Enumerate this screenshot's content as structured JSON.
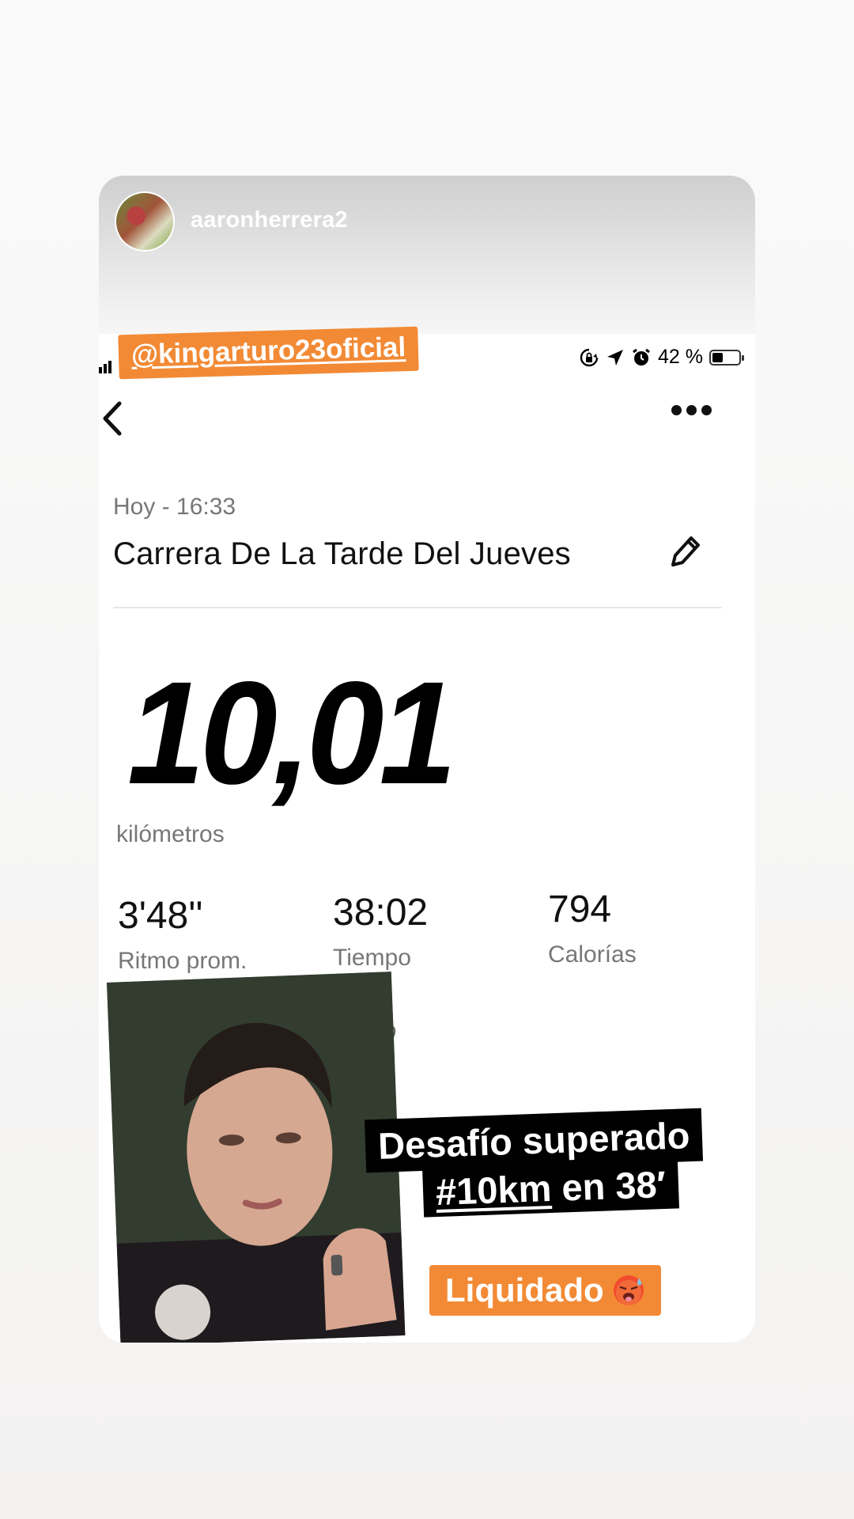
{
  "story": {
    "username": "aaronherrera2",
    "mention": "@kingarturo23oficial"
  },
  "status_bar": {
    "battery_percent": "42 %",
    "icons": [
      "orientation-lock-icon",
      "location-arrow-icon",
      "alarm-icon",
      "battery-icon"
    ]
  },
  "activity": {
    "date": "Hoy - 16:33",
    "title": "Carrera De La Tarde Del Jueves",
    "distance": "10,01",
    "distance_unit": "kilómetros",
    "stats": [
      {
        "value": "3'48''",
        "label": "Ritmo prom."
      },
      {
        "value": "38:02",
        "label": "Tiempo"
      },
      {
        "value": "794",
        "label": "Calorías"
      }
    ],
    "partial_text": "m."
  },
  "overlay": {
    "caption_line1": "Desafío superado",
    "caption_hashtag": "#10km",
    "caption_rest": " en 38′",
    "tag": "Liquidado",
    "emoji": "hot-face-emoji"
  },
  "colors": {
    "accent_orange": "#f28a35",
    "caption_bg": "#000000",
    "text_primary": "#111111",
    "text_secondary": "#777777"
  }
}
